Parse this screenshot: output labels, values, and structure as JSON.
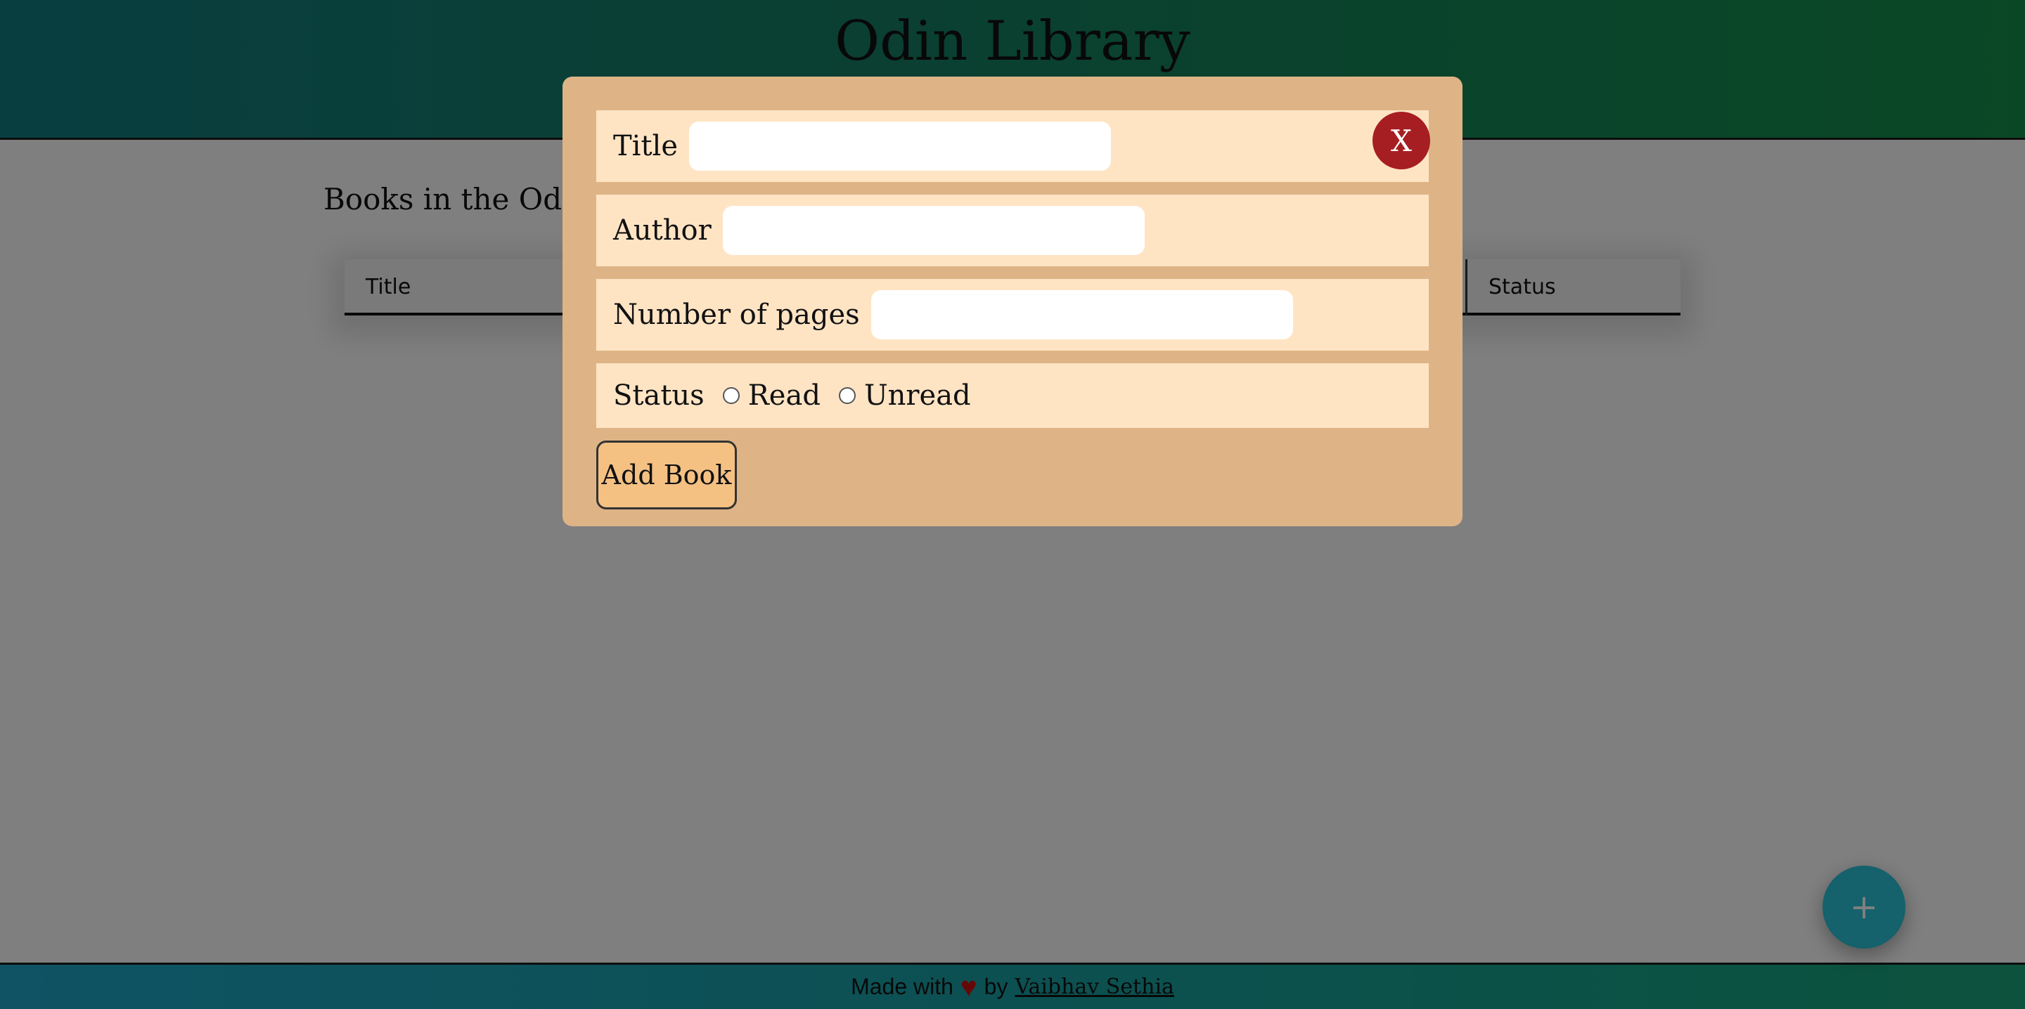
{
  "header": {
    "title": "Odin Library"
  },
  "main": {
    "books_heading": "Books in the Odin",
    "table": {
      "columns": [
        "Title",
        "Status"
      ]
    }
  },
  "footer": {
    "made_with": "Made with",
    "heart": "♥",
    "by": "by",
    "author_link": "Vaibhav Sethia"
  },
  "fab": {
    "label": "+"
  },
  "modal": {
    "close_label": "X",
    "fields": {
      "title_label": "Title",
      "title_value": "",
      "author_label": "Author",
      "author_value": "",
      "pages_label": "Number of pages",
      "pages_value": ""
    },
    "status": {
      "label": "Status",
      "options": [
        "Read",
        "Unread"
      ],
      "selected": null
    },
    "submit_label": "Add Book"
  }
}
